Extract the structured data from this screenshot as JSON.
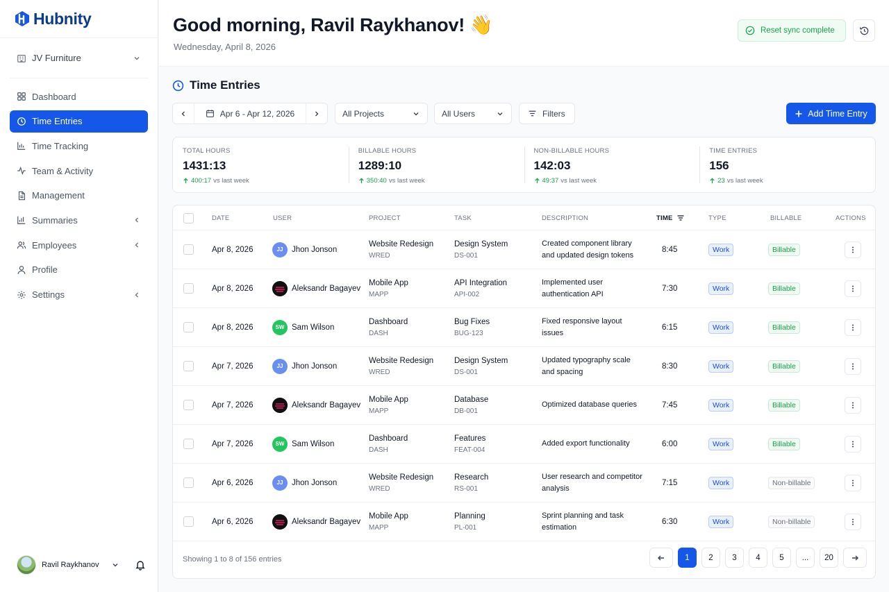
{
  "brand": {
    "name": "Hubnity",
    "color": "#0b3b8c",
    "accent": "#1557e8"
  },
  "sidebar": {
    "workspace": "JV Furniture",
    "items": [
      {
        "label": "Dashboard",
        "icon": "dashboard-icon",
        "active": false
      },
      {
        "label": "Time Entries",
        "icon": "clock-icon",
        "active": true
      },
      {
        "label": "Time Tracking",
        "icon": "bar-chart-icon",
        "active": false
      },
      {
        "label": "Team & Activity",
        "icon": "activity-icon",
        "active": false
      },
      {
        "label": "Management",
        "icon": "document-icon",
        "active": false
      },
      {
        "label": "Summaries",
        "icon": "bar-chart-icon",
        "active": false,
        "expandable": true
      },
      {
        "label": "Employees",
        "icon": "users-icon",
        "active": false,
        "expandable": true
      },
      {
        "label": "Profile",
        "icon": "user-icon",
        "active": false
      },
      {
        "label": "Settings",
        "icon": "gear-icon",
        "active": false,
        "expandable": true
      }
    ],
    "user": {
      "name": "Ravil Raykhanov"
    }
  },
  "header": {
    "greeting": "Good morning, Ravil Raykhanov! 👋",
    "date": "Wednesday, April 8, 2026",
    "sync_status": "Reset sync complete"
  },
  "section": {
    "title": "Time Entries"
  },
  "toolbar": {
    "date_range": "Apr 6 - Apr 12, 2026",
    "projects": "All Projects",
    "users": "All Users",
    "filters": "Filters",
    "add": "Add Time Entry"
  },
  "stats": [
    {
      "label": "TOTAL HOURS",
      "value": "1431:13",
      "change": "400:17",
      "suffix": "vs last week"
    },
    {
      "label": "BILLABLE HOURS",
      "value": "1289:10",
      "change": "350:40",
      "suffix": "vs last week"
    },
    {
      "label": "NON-BILLABLE HOURS",
      "value": "142:03",
      "change": "49:37",
      "suffix": "vs last week"
    },
    {
      "label": "TIME ENTRIES",
      "value": "156",
      "change": "23",
      "suffix": "vs last week"
    }
  ],
  "table": {
    "columns": {
      "date": "DATE",
      "user": "USER",
      "project": "PROJECT",
      "task": "TASK",
      "description": "DESCRIPTION",
      "time": "TIME",
      "type": "TYPE",
      "billable": "BILLABLE",
      "actions": "ACTIONS"
    },
    "rows": [
      {
        "date": "Apr 8, 2026",
        "initials": "JJ",
        "avatar_color": "#6b8ff0",
        "user": "Jhon Jonson",
        "project": "Website Redesign",
        "project_code": "WRED",
        "task": "Design System",
        "task_code": "DS-001",
        "description": "Created component library and updated design tokens",
        "time": "8:45",
        "type": "Work",
        "billable": "Billable"
      },
      {
        "date": "Apr 8, 2026",
        "initials": "",
        "avatar_color": "#111111",
        "user": "Aleksandr Bagayev",
        "project": "Mobile App",
        "project_code": "MAPP",
        "task": "API Integration",
        "task_code": "API-002",
        "description": "Implemented user authentication API",
        "time": "7:30",
        "type": "Work",
        "billable": "Billable"
      },
      {
        "date": "Apr 8, 2026",
        "initials": "SW",
        "avatar_color": "#22c55e",
        "user": "Sam Wilson",
        "project": "Dashboard",
        "project_code": "DASH",
        "task": "Bug Fixes",
        "task_code": "BUG-123",
        "description": "Fixed responsive layout issues",
        "time": "6:15",
        "type": "Work",
        "billable": "Billable"
      },
      {
        "date": "Apr 7, 2026",
        "initials": "JJ",
        "avatar_color": "#6b8ff0",
        "user": "Jhon Jonson",
        "project": "Website Redesign",
        "project_code": "WRED",
        "task": "Design System",
        "task_code": "DS-001",
        "description": "Updated typography scale and spacing",
        "time": "8:30",
        "type": "Work",
        "billable": "Billable"
      },
      {
        "date": "Apr 7, 2026",
        "initials": "",
        "avatar_color": "#111111",
        "user": "Aleksandr Bagayev",
        "project": "Mobile App",
        "project_code": "MAPP",
        "task": "Database",
        "task_code": "DB-001",
        "description": "Optimized database queries",
        "time": "7:45",
        "type": "Work",
        "billable": "Billable"
      },
      {
        "date": "Apr 7, 2026",
        "initials": "SW",
        "avatar_color": "#22c55e",
        "user": "Sam Wilson",
        "project": "Dashboard",
        "project_code": "DASH",
        "task": "Features",
        "task_code": "FEAT-004",
        "description": "Added export functionality",
        "time": "6:00",
        "type": "Work",
        "billable": "Billable"
      },
      {
        "date": "Apr 6, 2026",
        "initials": "JJ",
        "avatar_color": "#6b8ff0",
        "user": "Jhon Jonson",
        "project": "Website Redesign",
        "project_code": "WRED",
        "task": "Research",
        "task_code": "RS-001",
        "description": "User research and competitor analysis",
        "time": "7:15",
        "type": "Work",
        "billable": "Non-billable"
      },
      {
        "date": "Apr 6, 2026",
        "initials": "",
        "avatar_color": "#111111",
        "user": "Aleksandr Bagayev",
        "project": "Mobile App",
        "project_code": "MAPP",
        "task": "Planning",
        "task_code": "PL-001",
        "description": "Sprint planning and task estimation",
        "time": "6:30",
        "type": "Work",
        "billable": "Non-billable"
      }
    ]
  },
  "pagination": {
    "showing": "Showing 1 to 8 of 156 entries",
    "pages": [
      "1",
      "2",
      "3",
      "4",
      "5",
      "...",
      "20"
    ],
    "current": "1"
  }
}
